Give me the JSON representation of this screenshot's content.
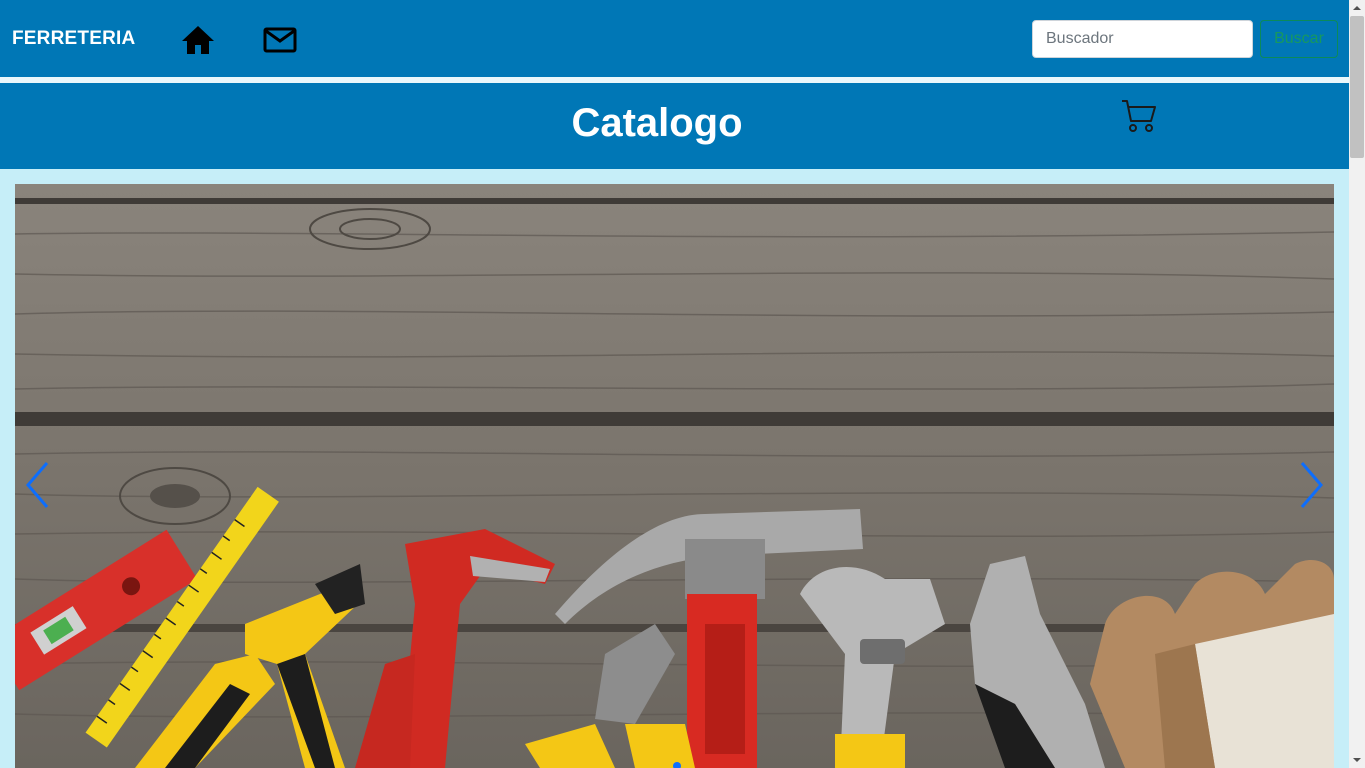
{
  "navbar": {
    "brand": "FERRETERIA",
    "icons": [
      "home-icon",
      "mail-icon"
    ],
    "search": {
      "placeholder": "Buscador",
      "value": ""
    },
    "search_button": "Buscar"
  },
  "header": {
    "title": "Catalogo",
    "cart_icon": "cart-icon"
  },
  "carousel": {
    "slide_image": "hardware tools on wooden planks",
    "prev_icon": "chevron-left-icon",
    "next_icon": "chevron-right-icon"
  },
  "colors": {
    "primary": "#0077b6",
    "background": "#c6eef8",
    "control": "#0d6efd",
    "success": "#17995f"
  }
}
